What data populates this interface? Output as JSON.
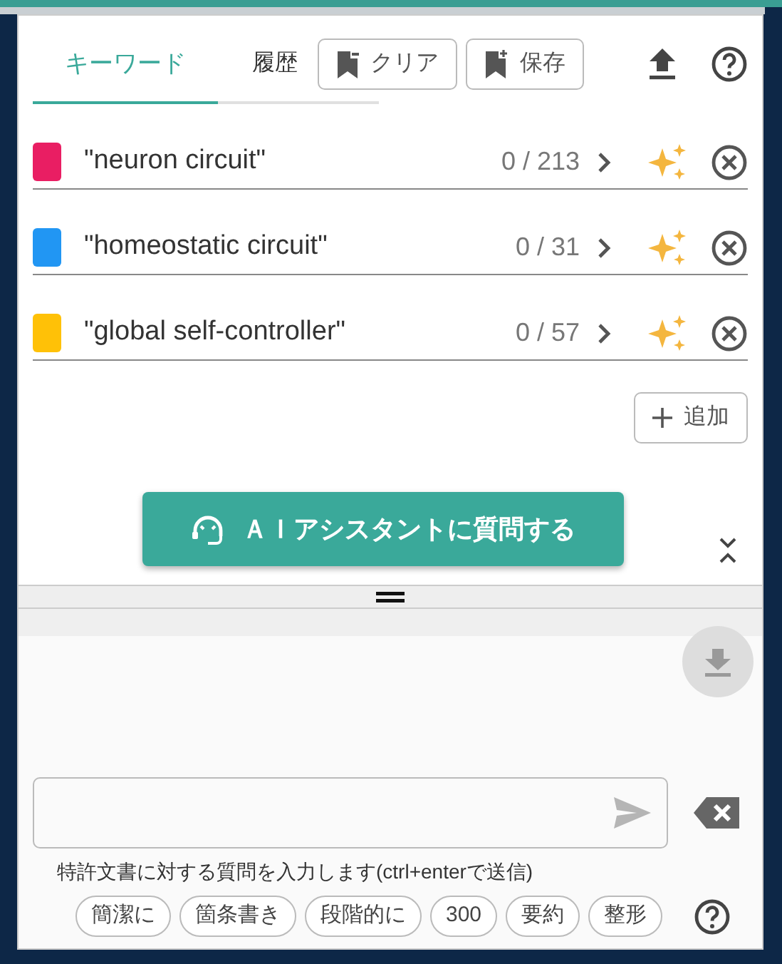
{
  "tabs": [
    {
      "label": "キーワード",
      "selected": true
    },
    {
      "label": "履歴",
      "selected": false
    }
  ],
  "toolbar_buttons": [
    {
      "label": "クリア",
      "kind": "clear"
    },
    {
      "label": "保存",
      "kind": "save"
    }
  ],
  "keywords": [
    {
      "text": "\"neuron circuit\"",
      "color": "#e91e63",
      "count": "0 / 213"
    },
    {
      "text": "\"homeostatic circuit\"",
      "color": "#2196f3",
      "count": "0 / 31"
    },
    {
      "text": "\"global self-controller\"",
      "color": "#ffc107",
      "count": "0 / 57"
    }
  ],
  "add_button": "追加",
  "ai_button": "ＡＩアシスタントに質問する",
  "question": {
    "hint": "特許文書に対する質問を入力します(ctrl+enterで送信)"
  },
  "chips": [
    "簡潔に",
    "箇条書き",
    "段階的に",
    "300",
    "要約",
    "整形"
  ]
}
